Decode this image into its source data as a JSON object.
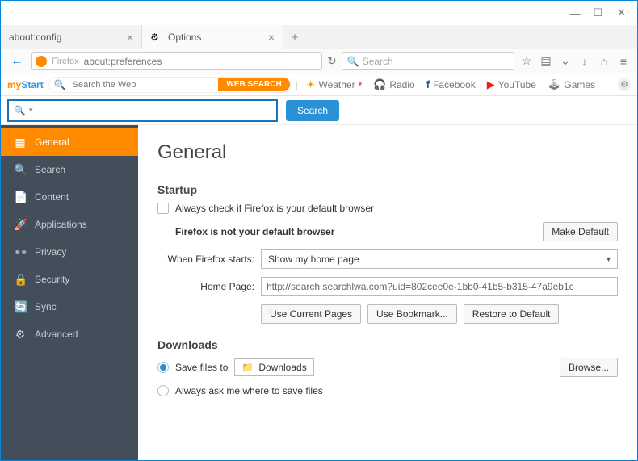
{
  "window": {
    "tabs": [
      {
        "label": "about:config"
      },
      {
        "label": "Options"
      }
    ],
    "urlbar": {
      "badge": "Firefox",
      "value": "about:preferences"
    },
    "search_placeholder": "Search",
    "toolbar_icons": [
      "star",
      "clipboard",
      "pocket",
      "download",
      "home",
      "menu"
    ]
  },
  "mystart": {
    "placeholder": "Search the Web",
    "button": "WEB SEARCH",
    "links": [
      {
        "icon": "☀",
        "label": "Weather",
        "dd": true
      },
      {
        "icon": "🎧",
        "label": "Radio"
      },
      {
        "icon": "f",
        "label": "Facebook"
      },
      {
        "icon": "▶",
        "label": "YouTube"
      },
      {
        "icon": "🕹",
        "label": "Games"
      }
    ]
  },
  "searchtool": {
    "button": "Search"
  },
  "sidebar": {
    "items": [
      {
        "icon": "▦",
        "label": "General",
        "active": true
      },
      {
        "icon": "🔍",
        "label": "Search"
      },
      {
        "icon": "📄",
        "label": "Content"
      },
      {
        "icon": "🚀",
        "label": "Applications"
      },
      {
        "icon": "👓",
        "label": "Privacy"
      },
      {
        "icon": "🔒",
        "label": "Security"
      },
      {
        "icon": "🔄",
        "label": "Sync"
      },
      {
        "icon": "⚙",
        "label": "Advanced"
      }
    ]
  },
  "prefs": {
    "title": "General",
    "startup": {
      "heading": "Startup",
      "always_check": "Always check if Firefox is your default browser",
      "not_default": "Firefox is not your default browser",
      "make_default": "Make Default",
      "when_starts_label": "When Firefox starts:",
      "when_starts_value": "Show my home page",
      "home_label": "Home Page:",
      "home_value": "http://search.searchlwa.com?uid=802cee0e-1bb0-41b5-b315-47a9eb1c",
      "use_current": "Use Current Pages",
      "use_bookmark": "Use Bookmark...",
      "restore": "Restore to Default"
    },
    "downloads": {
      "heading": "Downloads",
      "save_to": "Save files to",
      "folder": "Downloads",
      "browse": "Browse...",
      "always_ask": "Always ask me where to save files"
    }
  }
}
